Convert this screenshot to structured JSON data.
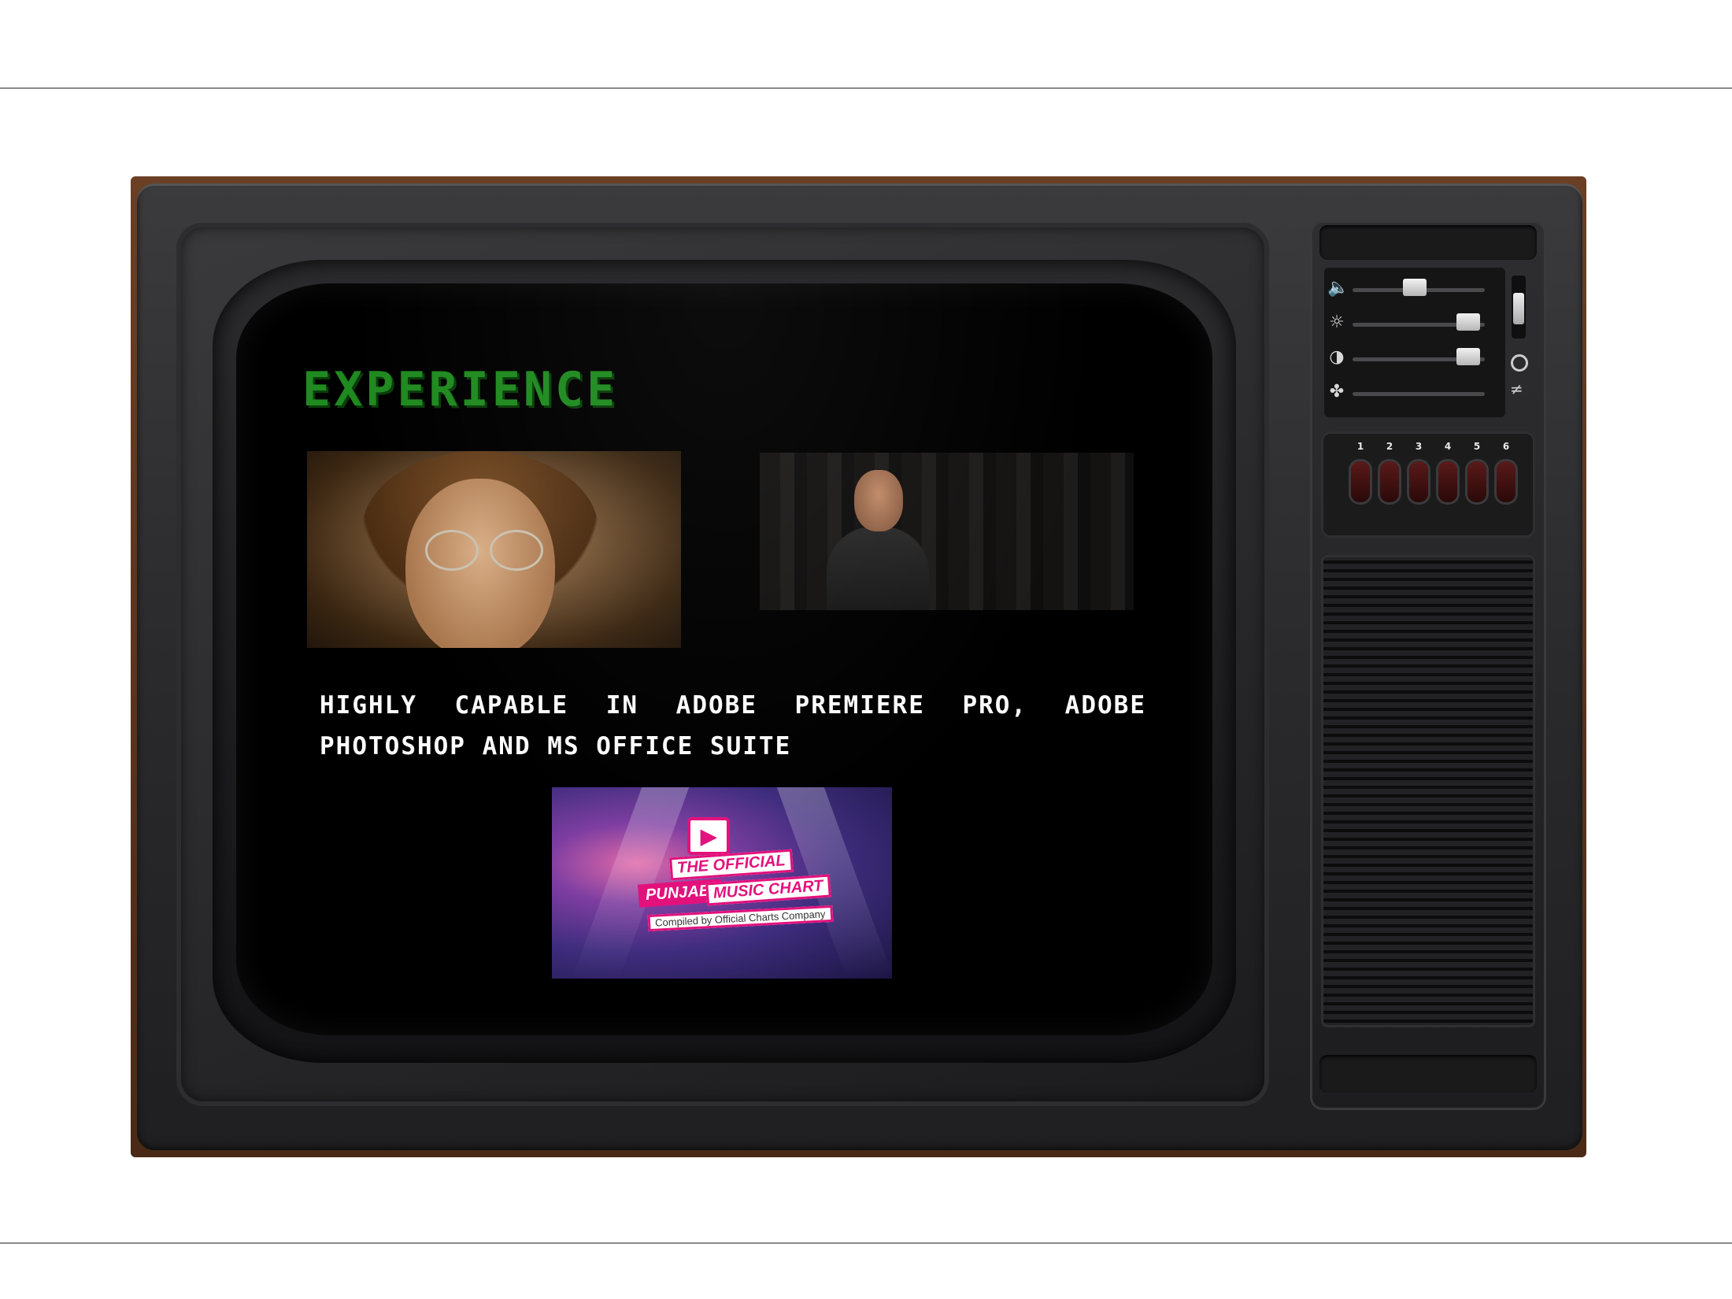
{
  "slide": {
    "title": "EXPERIENCE",
    "skills_text": "HIGHLY CAPABLE IN ADOBE PREMIERE PRO, ADOBE PHOTOSHOP AND MS OFFICE SUITE"
  },
  "chart_thumbnail": {
    "line1": "THE OFFICIAL",
    "line2": "PUNJABI",
    "line3": "MUSIC CHART",
    "compiled_by": "Compiled by",
    "company": "Official Charts Company"
  },
  "tv_controls": {
    "channels": [
      "1",
      "2",
      "3",
      "4",
      "5",
      "6"
    ]
  },
  "colors": {
    "title_green": "#1f8a1f",
    "screen_bg": "#000000",
    "accent_pink": "#e3117c"
  }
}
